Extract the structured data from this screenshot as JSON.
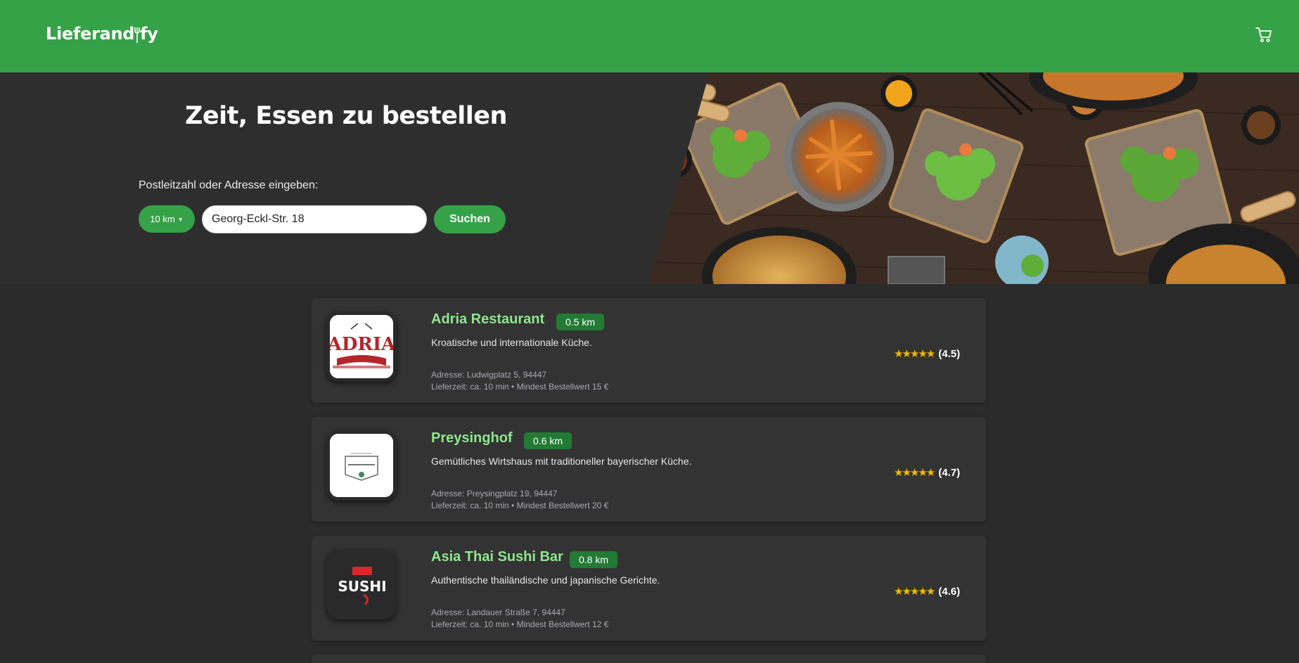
{
  "header": {
    "logo_text_left": "Lieferand",
    "logo_text_right": "fy",
    "cart_icon": "cart-icon"
  },
  "hero": {
    "title": "Zeit, Essen zu bestellen",
    "address_label": "Postleitzahl oder Adresse eingeben:",
    "radius_selected": "10 km",
    "address_value": "Georg-Eckl-Str. 18",
    "search_label": "Suchen"
  },
  "restaurants": [
    {
      "name": "Adria Restaurant",
      "distance": "0.5 km",
      "description": "Kroatische und internationale Küche.",
      "address": "Adresse: Ludwigplatz 5, 94447",
      "meta": "Lieferzeit: ca. 10 min • Mindest Bestellwert 15 €",
      "stars": "★★★★★",
      "rating": "(4.5)",
      "logo": "adria-logo"
    },
    {
      "name": "Preysinghof",
      "distance": "0.6 km",
      "description": "Gemütliches Wirtshaus mit traditioneller bayerischer Küche.",
      "address": "Adresse: Preysingplatz 19, 94447",
      "meta": "Lieferzeit: ca. 10 min • Mindest Bestellwert 20 €",
      "stars": "★★★★★",
      "rating": "(4.7)",
      "logo": "preysinghof-logo"
    },
    {
      "name": "Asia Thai Sushi Bar",
      "distance": "0.8 km",
      "description": "Authentische thailändische und japanische Gerichte.",
      "address": "Adresse: Landauer Straße 7, 94447",
      "meta": "Lieferzeit: ca. 10 min • Mindest Bestellwert 12 €",
      "stars": "★★★★★",
      "rating": "(4.6)",
      "logo": "asia-thai-sushi-logo"
    }
  ],
  "colors": {
    "brand_green": "#35a247",
    "badge_green": "#237a35",
    "name_green": "#8ee68e",
    "star": "#f5b800",
    "background": "#2b2b2b",
    "card": "#333333"
  }
}
